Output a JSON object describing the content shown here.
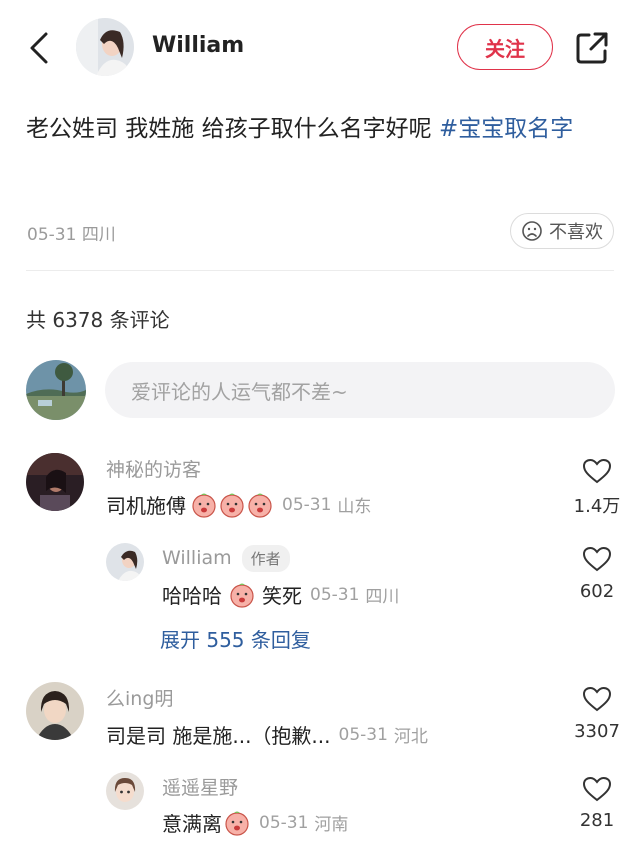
{
  "header": {
    "username": "William",
    "follow_label": "关注"
  },
  "post": {
    "text": "老公姓司 我姓施 给孩子取什么名字好呢 ",
    "hashtag": "#宝宝取名字",
    "date": "05-31",
    "location": "四川",
    "dislike_label": "不喜欢"
  },
  "comments_summary": {
    "count_text": "共 6378 条评论"
  },
  "comment_input": {
    "placeholder": "爱评论的人运气都不差~"
  },
  "comments": [
    {
      "name": "神秘的访客",
      "text": "司机施傅",
      "emoji_count": 3,
      "date": "05-31",
      "location": "山东",
      "likes": "1.4万"
    },
    {
      "name": "William",
      "badge": "作者",
      "text_a": "哈哈哈",
      "text_b": "笑死",
      "date": "05-31",
      "location": "四川",
      "likes": "602"
    },
    {
      "expand_text": "展开 555 条回复"
    },
    {
      "name": "么ing明",
      "text": "司是司 施是施...（抱歉...",
      "date": "05-31",
      "location": "河北",
      "likes": "3307"
    },
    {
      "name": "遥遥星野",
      "text": "意满离",
      "date": "05-31",
      "location": "河南",
      "likes": "281"
    }
  ],
  "colors": {
    "accent_red": "#e0334a",
    "link_blue": "#2f5e9e",
    "meta_gray": "#9b9b9b"
  },
  "icons": [
    "back-icon",
    "share-icon",
    "dislike-face-icon",
    "heart-icon",
    "emoji-peach-icon"
  ]
}
